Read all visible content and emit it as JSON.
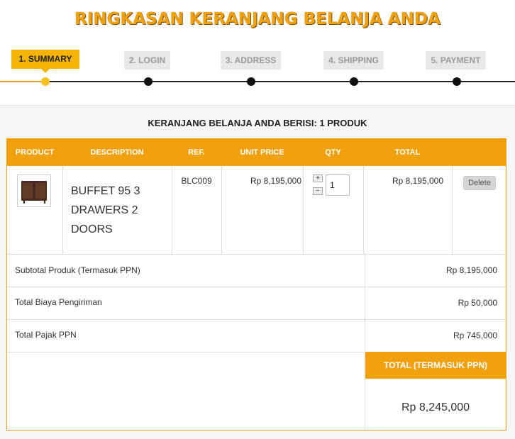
{
  "page": {
    "title": "RINGKASAN KERANJANG BELANJA ANDA"
  },
  "steps": [
    {
      "label": "1. SUMMARY",
      "active": true
    },
    {
      "label": "2. LOGIN",
      "active": false
    },
    {
      "label": "3. ADDRESS",
      "active": false
    },
    {
      "label": "4. SHIPPING",
      "active": false
    },
    {
      "label": "5. PAYMENT",
      "active": false
    }
  ],
  "cart": {
    "heading": "KERANJANG BELANJA ANDA BERISI: 1 PRODUK",
    "columns": [
      "PRODUCT",
      "DESCRIPTION",
      "REF.",
      "UNIT PRICE",
      "QTY",
      "TOTAL"
    ],
    "items": [
      {
        "image_icon": "buffet-cabinet-image",
        "description": "BUFFET 95 3 DRAWERS 2 DOORS",
        "ref": "BLC009",
        "unit_price": "Rp 8,195,000",
        "qty_plus": "+",
        "qty_minus": "−",
        "qty": "1",
        "total": "Rp 8,195,000",
        "delete_label": "Delete"
      }
    ],
    "summary": {
      "subtotal_label": "Subtotal Produk (Termasuk PPN)",
      "subtotal_value": "Rp 8,195,000",
      "shipping_label": "Total Biaya Pengiriman",
      "shipping_value": "Rp 50,000",
      "tax_label": "Total Pajak PPN",
      "tax_value": "Rp 745,000",
      "total_label": "TOTAL (TERMASUK PPN)",
      "total_value": "Rp 8,245,000"
    }
  },
  "colors": {
    "accent": "#f2a10e",
    "step_active": "#f5b400",
    "step_inactive": "#e8e8e8"
  }
}
